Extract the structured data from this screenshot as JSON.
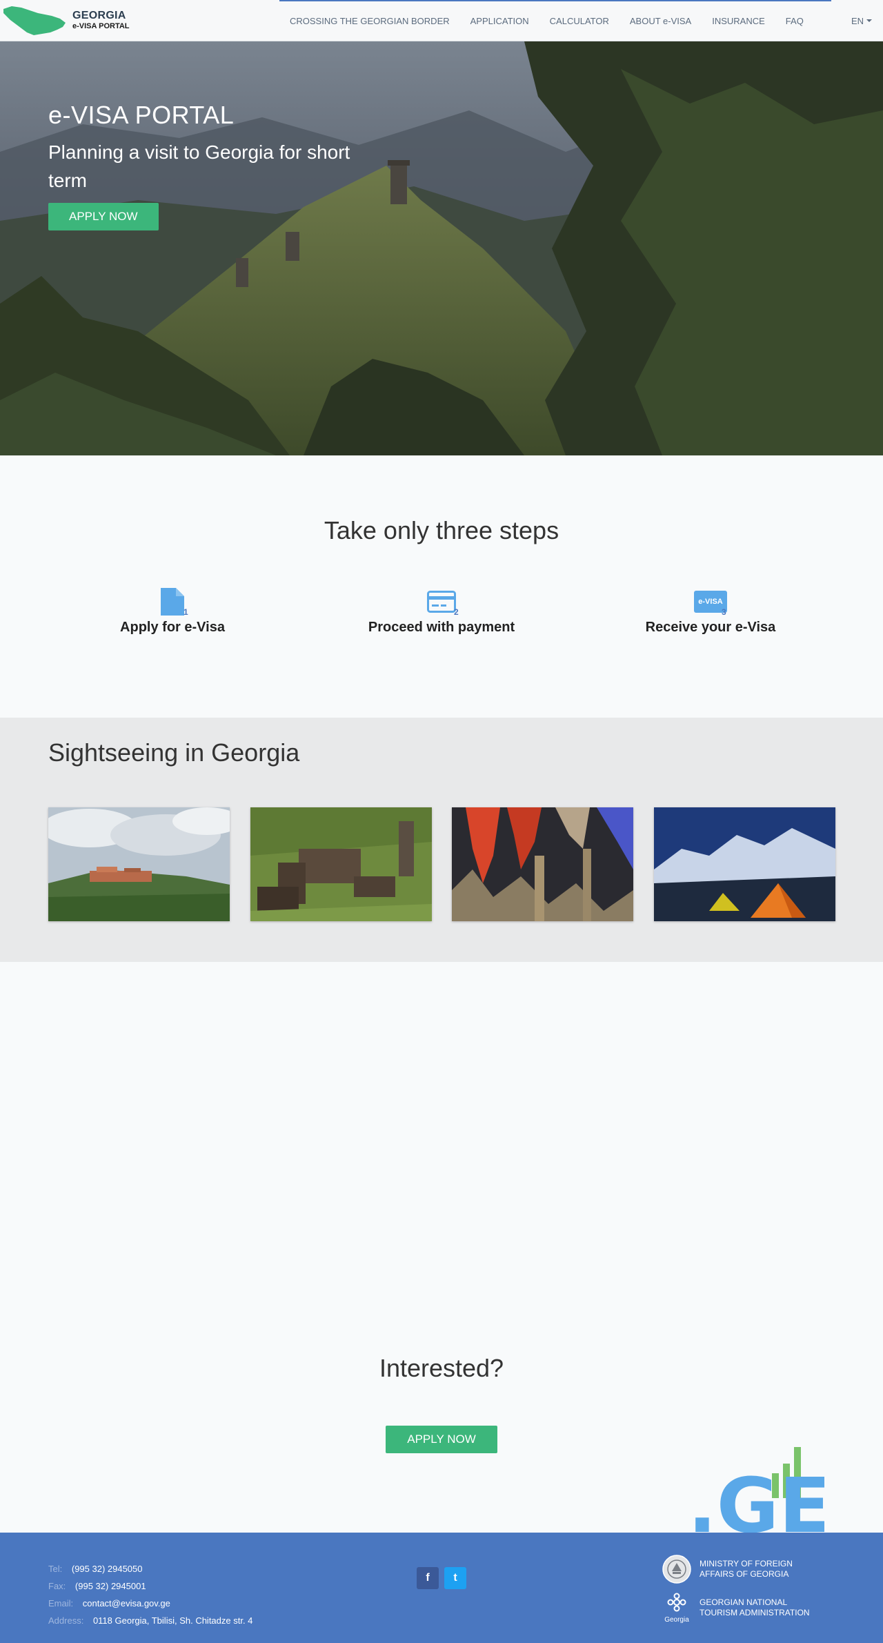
{
  "navbar": {
    "brand_title": "GEORGIA",
    "brand_sub": "e-VISA PORTAL",
    "links": [
      "CROSSING THE GEORGIAN BORDER",
      "APPLICATION",
      "CALCULATOR",
      "ABOUT e-VISA",
      "INSURANCE",
      "FAQ"
    ],
    "lang": "EN"
  },
  "hero": {
    "title": "e-VISA PORTAL",
    "subtitle": "Planning a visit to Georgia for short term",
    "apply_label": "APPLY NOW"
  },
  "steps": {
    "title": "Take only three steps",
    "items": [
      {
        "label": "Apply for e-Visa",
        "number": "1",
        "icon": "document-icon"
      },
      {
        "label": "Proceed with payment",
        "number": "2",
        "icon": "credit-card-icon"
      },
      {
        "label": "Receive your e-Visa",
        "number": "3",
        "icon": "evisa-card-icon",
        "badge": "e-VISA"
      }
    ]
  },
  "sightseeing": {
    "title": "Sightseeing in Georgia",
    "images": [
      "hilltop-town-photo",
      "stone-towers-village-photo",
      "cave-formations-photo",
      "mountain-camping-photo"
    ]
  },
  "interested": {
    "title": "Interested?",
    "apply_label": "APPLY NOW"
  },
  "ge_logo": {
    "text": ".GE"
  },
  "footer": {
    "contacts": [
      {
        "key": "Tel:",
        "value": "(995 32) 2945050"
      },
      {
        "key": "Fax:",
        "value": "(995 32) 2945001"
      },
      {
        "key": "Email:",
        "value": "contact@evisa.gov.ge"
      },
      {
        "key": "Address:",
        "value": "0118 Georgia, Tbilisi, Sh. Chitadze str. 4"
      }
    ],
    "social": {
      "facebook": "f",
      "twitter": "t"
    },
    "gov": [
      {
        "line1": "MINISTRY OF FOREIGN",
        "line2": "AFFAIRS OF GEORGIA"
      },
      {
        "line1": "GEORGIAN NATIONAL",
        "line2": "TOURISM ADMINISTRATION",
        "logo_text": "Georgia"
      }
    ]
  },
  "colors": {
    "accent_green": "#3cb67b",
    "footer_blue": "#4a77c0",
    "icon_blue": "#5aa8e8",
    "nav_text": "#5b6b7e"
  }
}
